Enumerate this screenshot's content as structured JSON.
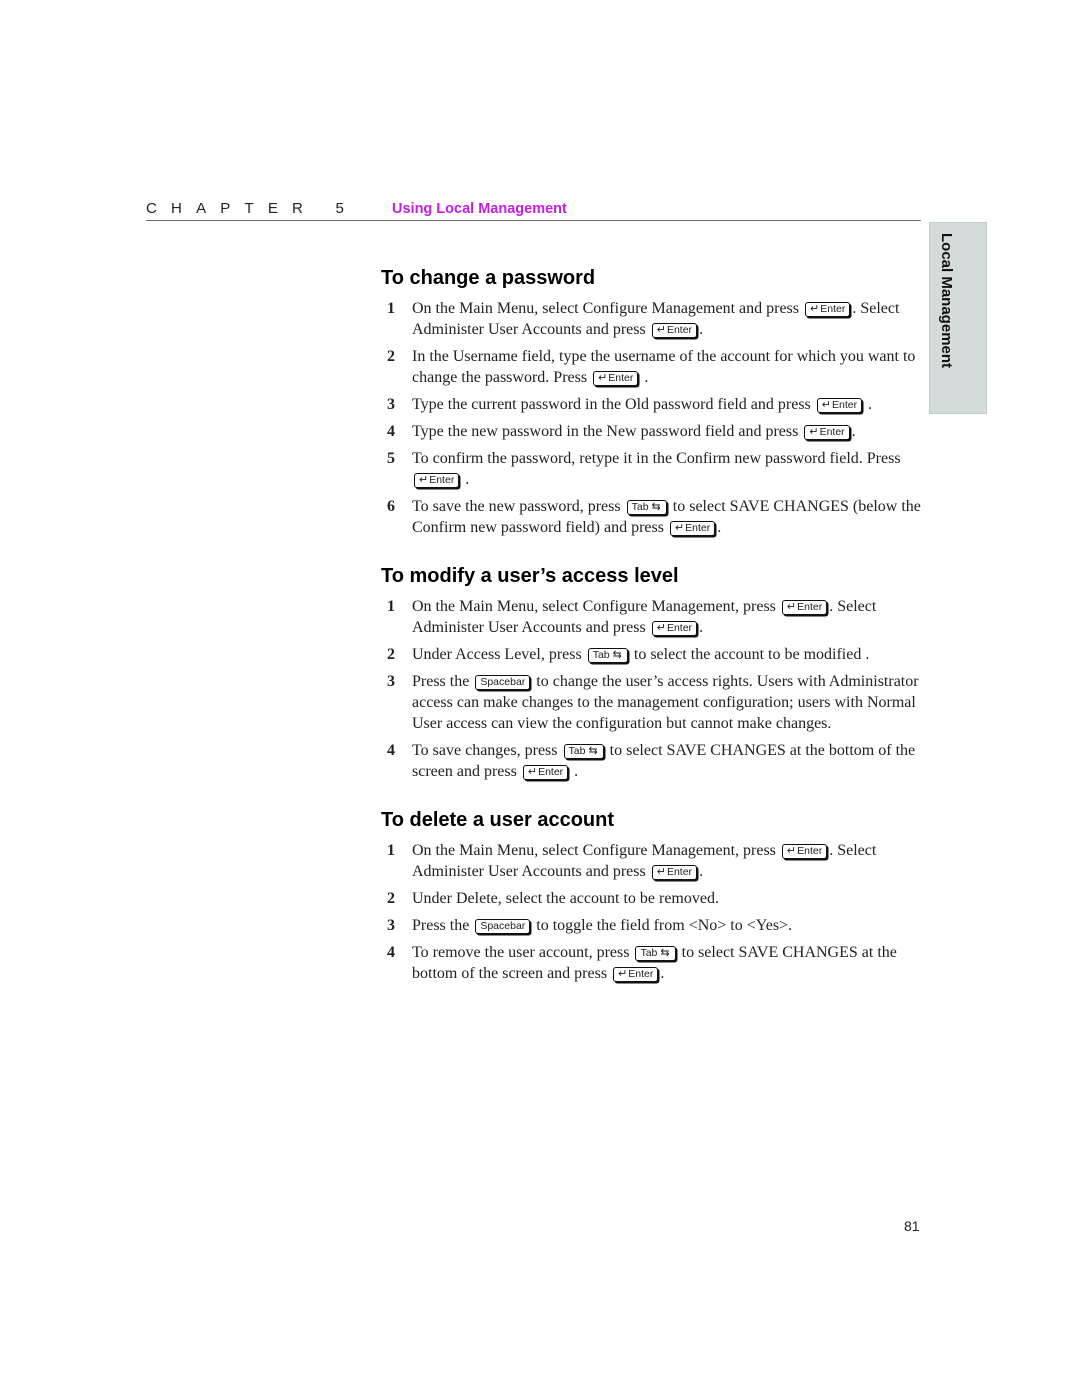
{
  "header": {
    "chapter_label": "CHAPTER 5",
    "chapter_title": "Using Local Management",
    "accent_color": "#c21fe0"
  },
  "side_tab": {
    "label": "Local Management",
    "background": "#d3dcdb"
  },
  "keys": {
    "enter": {
      "glyph": "↵",
      "label": "Enter"
    },
    "tab": {
      "label": "Tab",
      "glyph": "⇆"
    },
    "spacebar": {
      "label": "Spacebar"
    }
  },
  "sections": [
    {
      "title": "To change a password",
      "steps": [
        {
          "num": "1",
          "parts": [
            {
              "t": "On the Main Menu, select Configure Management and press "
            },
            {
              "k": "enter"
            },
            {
              "t": ". Select Administer User Accounts and press "
            },
            {
              "k": "enter"
            },
            {
              "t": "."
            }
          ]
        },
        {
          "num": "2",
          "parts": [
            {
              "t": "In the Username field, type the username of the account for which you want to change the password. Press "
            },
            {
              "k": "enter"
            },
            {
              "t": " ."
            }
          ]
        },
        {
          "num": "3",
          "parts": [
            {
              "t": "Type the current password in the Old password field and press "
            },
            {
              "k": "enter"
            },
            {
              "t": " ."
            }
          ]
        },
        {
          "num": "4",
          "parts": [
            {
              "t": "Type the new password in the New password field and press "
            },
            {
              "k": "enter"
            },
            {
              "t": "."
            }
          ]
        },
        {
          "num": "5",
          "parts": [
            {
              "t": "To confirm the password, retype it in the Confirm new password field. Press "
            },
            {
              "k": "enter"
            },
            {
              "t": " ."
            }
          ]
        },
        {
          "num": "6",
          "parts": [
            {
              "t": "To save the new password, press "
            },
            {
              "k": "tab"
            },
            {
              "t": " to select SAVE CHANGES (below the Confirm new password field) and press "
            },
            {
              "k": "enter"
            },
            {
              "t": "."
            }
          ]
        }
      ]
    },
    {
      "title": "To modify a user’s access level",
      "steps": [
        {
          "num": "1",
          "parts": [
            {
              "t": "On the Main Menu, select Configure Management, press "
            },
            {
              "k": "enter"
            },
            {
              "t": ". Select Administer User Accounts and press "
            },
            {
              "k": "enter"
            },
            {
              "t": "."
            }
          ]
        },
        {
          "num": "2",
          "parts": [
            {
              "t": "Under Access Level, press "
            },
            {
              "k": "tab"
            },
            {
              "t": " to select the account to be modified ."
            }
          ]
        },
        {
          "num": "3",
          "parts": [
            {
              "t": "Press the "
            },
            {
              "k": "spacebar"
            },
            {
              "t": " to change the user’s access rights. Users with Administrator access can make changes to the management configuration; users with Normal User access can view the configuration but cannot make changes."
            }
          ]
        },
        {
          "num": "4",
          "parts": [
            {
              "t": "To save changes, press "
            },
            {
              "k": "tab"
            },
            {
              "t": " to select SAVE CHANGES at the bottom of the screen and press "
            },
            {
              "k": "enter"
            },
            {
              "t": " ."
            }
          ]
        }
      ]
    },
    {
      "title": "To delete a user account",
      "steps": [
        {
          "num": "1",
          "parts": [
            {
              "t": "On the Main Menu, select Configure Management, press "
            },
            {
              "k": "enter"
            },
            {
              "t": ". Select Administer User Accounts and press "
            },
            {
              "k": "enter"
            },
            {
              "t": "."
            }
          ]
        },
        {
          "num": "2",
          "parts": [
            {
              "t": "Under Delete, select the account to be removed."
            }
          ]
        },
        {
          "num": "3",
          "parts": [
            {
              "t": "Press the "
            },
            {
              "k": "spacebar"
            },
            {
              "t": " to toggle the field from <No> to <Yes>."
            }
          ]
        },
        {
          "num": "4",
          "parts": [
            {
              "t": "To remove the user account, press "
            },
            {
              "k": "tab"
            },
            {
              "t": " to select SAVE CHANGES at the bottom of the screen and press "
            },
            {
              "k": "enter"
            },
            {
              "t": "."
            }
          ]
        }
      ]
    }
  ],
  "page_number": "81"
}
